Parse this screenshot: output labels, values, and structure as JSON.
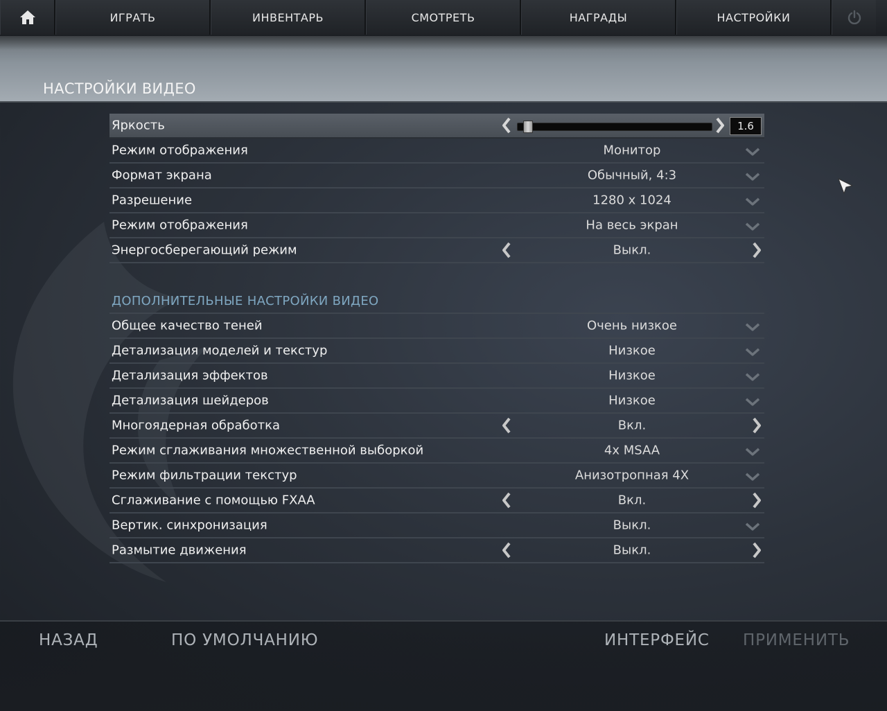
{
  "nav": {
    "home_icon": "home-icon",
    "items": [
      {
        "label": "ИГРАТЬ"
      },
      {
        "label": "ИНВЕНТАРЬ"
      },
      {
        "label": "СМОТРЕТЬ"
      },
      {
        "label": "НАГРАДЫ"
      },
      {
        "label": "НАСТРОЙКИ"
      }
    ],
    "power_icon": "power-icon"
  },
  "page": {
    "title": "НАСТРОЙКИ ВИДЕО"
  },
  "brightness": {
    "label": "Яркость",
    "value": "1.6",
    "slider_fraction": 0.02
  },
  "basic": [
    {
      "label": "Режим отображения",
      "value": "Монитор",
      "control": "dropdown"
    },
    {
      "label": "Формат экрана",
      "value": "Обычный, 4:3",
      "control": "dropdown"
    },
    {
      "label": "Разрешение",
      "value": "1280 x 1024",
      "control": "dropdown"
    },
    {
      "label": "Режим отображения",
      "value": "На весь экран",
      "control": "dropdown"
    },
    {
      "label": "Энергосберегающий режим",
      "value": "Выкл.",
      "control": "toggle"
    }
  ],
  "advanced": {
    "title": "ДОПОЛНИТЕЛЬНЫЕ НАСТРОЙКИ ВИДЕО",
    "rows": [
      {
        "label": "Общее качество теней",
        "value": "Очень низкое",
        "control": "dropdown"
      },
      {
        "label": "Детализация моделей и текстур",
        "value": "Низкое",
        "control": "dropdown"
      },
      {
        "label": "Детализация эффектов",
        "value": "Низкое",
        "control": "dropdown"
      },
      {
        "label": "Детализация шейдеров",
        "value": "Низкое",
        "control": "dropdown"
      },
      {
        "label": "Многоядерная обработка",
        "value": "Вкл.",
        "control": "toggle"
      },
      {
        "label": "Режим сглаживания множественной выборкой",
        "value": "4x MSAA",
        "control": "dropdown"
      },
      {
        "label": "Режим фильтрации текстур",
        "value": "Анизотропная 4X",
        "control": "dropdown"
      },
      {
        "label": "Сглаживание с помощью FXAA",
        "value": "Вкл.",
        "control": "toggle"
      },
      {
        "label": "Вертик. синхронизация",
        "value": "Выкл.",
        "control": "dropdown"
      },
      {
        "label": "Размытие движения",
        "value": "Выкл.",
        "control": "toggle"
      }
    ]
  },
  "footer": {
    "back": "НАЗАД",
    "defaults": "ПО УМОЛЧАНИЮ",
    "interface": "ИНТЕРФЕЙС",
    "apply": "ПРИМЕНИТЬ"
  },
  "colors": {
    "section_title": "#7fa7c1",
    "text": "#f0f0f0",
    "disabled": "#5f656b"
  }
}
